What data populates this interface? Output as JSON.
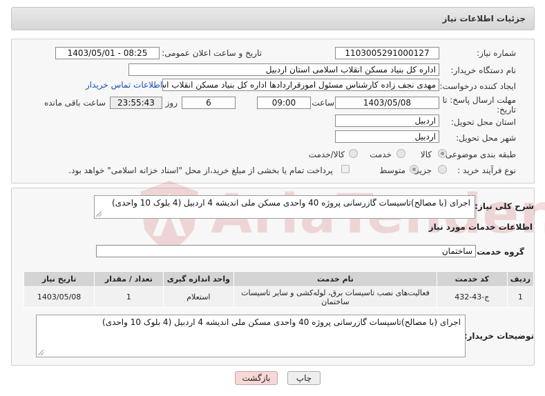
{
  "header": {
    "title": "جزئیات اطلاعات نیاز"
  },
  "fields": {
    "need_number_label": "شماره نیاز:",
    "need_number": "1103005291000127",
    "announce_label": "تاریخ و ساعت اعلان عمومی:",
    "announce_value": "1403/05/01 - 08:25",
    "buyer_org_label": "نام دستگاه خریدار:",
    "buyer_org": "اداره کل بنیاد مسکن انقلاب اسلامی استان اردبیل",
    "requester_label": "ایجاد کننده درخواست:",
    "requester": "مهدی نجف زاده کارشناس مسئول امورقراردادها اداره کل بنیاد مسکن انقلاب اسلامی",
    "contact_link": "اطلاعات تماس خریدار",
    "deadline_label_1": "مهلت ارسال پاسخ: تا",
    "deadline_label_2": "تاریخ:",
    "deadline_date": "1403/05/08",
    "time_label": "ساعت",
    "deadline_time": "09:00",
    "days_value": "6",
    "days_label": "روز و",
    "remaining_time": "23:55:43",
    "remaining_label": "ساعت باقی مانده",
    "province_label": "استان محل تحویل:",
    "province": "اردبیل",
    "city_label": "شهر محل تحویل:",
    "city": "اردبیل",
    "category_label": "طبقه بندی موضوعی:",
    "category_options": [
      "کالا",
      "خدمت",
      "کالا/خدمت"
    ],
    "process_label": "نوع فرآیند خرید :",
    "process_options": [
      "جزیی",
      "متوسط"
    ],
    "payment_note": "پرداخت تمام یا بخشی از مبلغ خرید،از محل \"اسناد خزانه اسلامی\" خواهد بود."
  },
  "summary": {
    "label": "شرح کلی نیاز:",
    "text": "اجرای (با مصالح)تاسیسات گازرسانی پروژه 40 واحدی مسکن ملی اندیشه 4 اردبیل (4 بلوک 10 واحدی)"
  },
  "services": {
    "section_title": "اطلاعات خدمات مورد نیاز",
    "group_label": "گروه خدمت:",
    "group_value": "ساختمان",
    "columns": [
      "ردیف",
      "کد خدمت",
      "نام خدمت",
      "واحد اندازه گیری",
      "تعداد / مقدار",
      "تاریخ نیاز"
    ],
    "rows": [
      [
        "1",
        "ج-43-432",
        "فعالیت‌های نصب تاسیسات برق، لوله‌کشی و سایر تاسیسات ساختمان",
        "استعلام",
        "1",
        "1403/05/08"
      ]
    ]
  },
  "buyer_notes": {
    "label": "توضیحات خریدار:",
    "text": "اجرای (با مصالح)تاسیسات گازرسانی پروژه 40 واحدی مسکن ملی اندیشه 4 اردبیل (4 بلوک 10 واحدی)"
  },
  "buttons": {
    "print": "چاپ",
    "back": "بازگشت"
  },
  "watermark": {
    "text": "AriaTender.neT"
  },
  "colors": {
    "link": "#1a4fb3",
    "back_button": "#f8d7d7",
    "print_button": "#eeeeee"
  }
}
